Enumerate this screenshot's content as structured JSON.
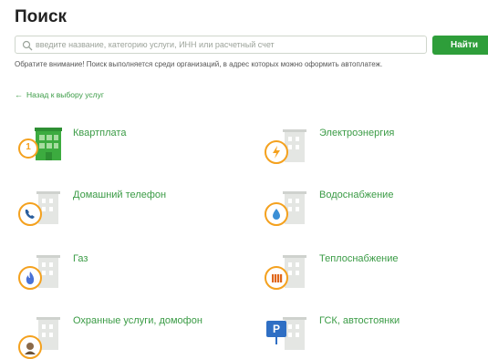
{
  "page": {
    "title": "Поиск"
  },
  "search": {
    "placeholder": "введите название, категорию услуги, ИНН или расчетный счет",
    "button_label": "Найти"
  },
  "notice": "Обратите внимание! Поиск выполняется среди организаций, в адрес которых можно оформить автоплатеж.",
  "back_link": {
    "label": "Назад к выбору услуг"
  },
  "categories": [
    {
      "label": "Квартплата",
      "icon": "apartment-building-icon",
      "badge": "1"
    },
    {
      "label": "Электроэнергия",
      "icon": "lightning-icon"
    },
    {
      "label": "Домашний телефон",
      "icon": "phone-icon"
    },
    {
      "label": "Водоснабжение",
      "icon": "water-drop-icon"
    },
    {
      "label": "Газ",
      "icon": "gas-flame-icon"
    },
    {
      "label": "Теплоснабжение",
      "icon": "radiator-icon"
    },
    {
      "label": "Охранные услуги, домофон",
      "icon": "guard-icon"
    },
    {
      "label": "ГСК, автостоянки",
      "icon": "parking-icon",
      "icon_text": "P"
    }
  ],
  "colors": {
    "accent_green": "#2e9e3a",
    "link_green": "#3a9b45",
    "badge_orange": "#f4a11e",
    "building_gray": "#d9dbd8"
  }
}
